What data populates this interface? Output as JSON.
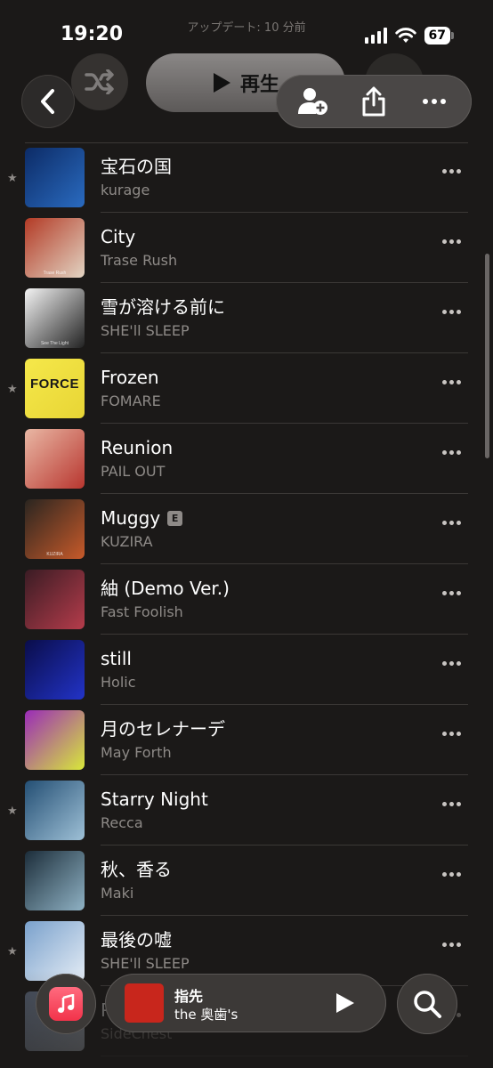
{
  "status_bar": {
    "time": "19:20",
    "battery_level": "67",
    "icons": [
      "signal-icon",
      "wifi-icon",
      "battery-icon"
    ]
  },
  "playlist": {
    "updated_text": "アップデート: 10 分前"
  },
  "header": {
    "play_label": "再生",
    "buttons": [
      "back-icon",
      "shuffle-icon",
      "play-icon",
      "add-collaborator-icon",
      "share-icon",
      "more-icon"
    ]
  },
  "songs": [
    {
      "title": "宝石の国",
      "artist": "kurage",
      "favorite": true,
      "explicit": false,
      "art_colors": [
        "#0c2b66",
        "#2a6bc0"
      ]
    },
    {
      "title": "City",
      "artist": "Trase Rush",
      "favorite": false,
      "explicit": false,
      "art_colors": [
        "#b33a25",
        "#e2d4c3"
      ],
      "art_text": "Trase Rush"
    },
    {
      "title": "雪が溶ける前に",
      "artist": "SHE'll SLEEP",
      "favorite": false,
      "explicit": false,
      "art_colors": [
        "#f4f4f4",
        "#222222"
      ],
      "art_text": "See The Light"
    },
    {
      "title": "Frozen",
      "artist": "FOMARE",
      "favorite": true,
      "explicit": false,
      "art_colors": [
        "#f5e84a",
        "#e8d535"
      ],
      "art_text": "FORCE"
    },
    {
      "title": "Reunion",
      "artist": "PAIL OUT",
      "favorite": false,
      "explicit": false,
      "art_colors": [
        "#e9b7a4",
        "#b8362f"
      ]
    },
    {
      "title": "Muggy",
      "artist": "KUZIRA",
      "favorite": false,
      "explicit": true,
      "explicit_label": "E",
      "art_colors": [
        "#2a2520",
        "#c75a2a"
      ],
      "art_text": "KUZIRA"
    },
    {
      "title": "紬 (Demo Ver.)",
      "artist": "Fast Foolish",
      "favorite": false,
      "explicit": false,
      "art_colors": [
        "#3a1c24",
        "#b53c4b"
      ]
    },
    {
      "title": "still",
      "artist": "Holic",
      "favorite": false,
      "explicit": false,
      "art_colors": [
        "#0a0d4a",
        "#2233c7"
      ]
    },
    {
      "title": "月のセレナーデ",
      "artist": "May Forth",
      "favorite": false,
      "explicit": false,
      "art_colors": [
        "#9a2bb8",
        "#d8e83a"
      ]
    },
    {
      "title": "Starry Night",
      "artist": "Recca",
      "favorite": true,
      "explicit": false,
      "art_colors": [
        "#244f74",
        "#9ec0d6"
      ]
    },
    {
      "title": "秋、香る",
      "artist": "Maki",
      "favorite": false,
      "explicit": false,
      "art_colors": [
        "#1c2d3a",
        "#8fb2c4"
      ]
    },
    {
      "title": "最後の嘘",
      "artist": "SHE'll SLEEP",
      "favorite": true,
      "explicit": false,
      "art_colors": [
        "#7aa1cc",
        "#e4ecf5"
      ]
    },
    {
      "title": "P",
      "artist": "SideChest",
      "favorite": false,
      "explicit": false,
      "art_colors": [
        "#8ca3c8",
        "#d5e1ef"
      ]
    }
  ],
  "mini_player": {
    "title": "指先",
    "artist": "the 奥歯's",
    "art_color": "#c8261c"
  },
  "bottom_nav": {
    "music_app_icon": "music-note-icon",
    "search_icon": "search-icon",
    "accent_color": "#f2334a"
  }
}
